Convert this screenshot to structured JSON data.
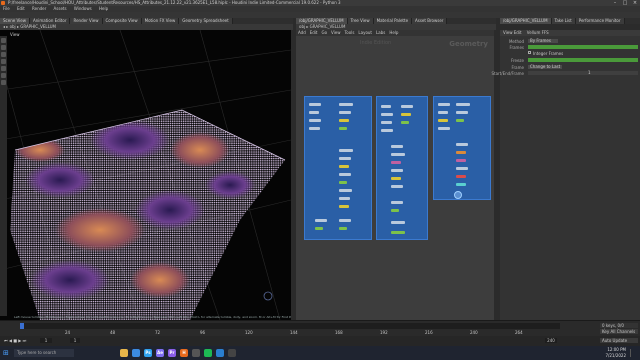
{
  "window": {
    "title": "P:/freelance/Houdini_School/HOU_Attributes/StudentResources/HS_Attributes_21.12.22_v21.3625E1_L58.hiplc - Houdini Indie Limited-Commercial 19.0.622 - Python 3"
  },
  "menu": {
    "items": [
      "File",
      "Edit",
      "Render",
      "Assets",
      "Windows",
      "Help"
    ]
  },
  "viewer": {
    "tabs": [
      "Scene View",
      "Animation Editor",
      "Render View",
      "Composite View",
      "Motion FX View",
      "Geometry Spreadsheet"
    ],
    "path": "obj",
    "node": "GRAPHIC_VELLUM",
    "view_label": "View",
    "status": "Left mouse tumbles. Middle pans. Right dollies. Ctrl+Alt+Left box-zooms. Ctrl+Right zooms. Spacebar Ctrl+Left tilts. Hold L for alternate tumble, dolly, and zoom.    M or Alt+M for First Person Navigation."
  },
  "network": {
    "tabs": [
      "/obj/GRAPHIC_VELLUM",
      "Tree View",
      "Material Palette",
      "Asset Browser"
    ],
    "menu": [
      "Add",
      "Edit",
      "Go",
      "View",
      "Tools",
      "Layout",
      "Labs",
      "Help"
    ],
    "path": "obj",
    "node": "GRAPHIC_VELLUM",
    "context_label": "Geometry",
    "mode_label": "Indie Edition"
  },
  "params": {
    "tabs": [
      "/obj/GRAPHIC_VELLUM",
      "Take List",
      "Performance Monitor"
    ],
    "node_type": "View Edit",
    "node_name": "Vellum FFS",
    "rows": [
      {
        "label": "Method",
        "value": "By Frames"
      },
      {
        "label": "Frames",
        "value": ""
      },
      {
        "label": "",
        "value": "Integer Frames"
      },
      {
        "label": "Freeze",
        "value": ""
      },
      {
        "label": "Frame",
        "value": "Change to Last"
      },
      {
        "label": "Start/End/Frame",
        "value": "1"
      }
    ]
  },
  "timeline": {
    "ticks": [
      "24",
      "48",
      "72",
      "96",
      "120",
      "144",
      "168",
      "192",
      "216",
      "240",
      "264"
    ],
    "frame": "1",
    "start": "1",
    "end": "240",
    "current": "1",
    "fps_label": "0 keys, 0/0 channels",
    "key_all": "Key All Channels",
    "auto_update": "Auto Update"
  },
  "taskbar": {
    "search_placeholder": "Type here to search",
    "time": "12:00 PM",
    "date": "7/21/2022",
    "apps": [
      {
        "name": "explorer",
        "color": "#e8b64a",
        "glyph": ""
      },
      {
        "name": "chrome",
        "color": "#3c8be0",
        "glyph": ""
      },
      {
        "name": "photoshop",
        "color": "#2fa3f0",
        "glyph": "Ps"
      },
      {
        "name": "after-effects",
        "color": "#7d6ef0",
        "glyph": "Ae"
      },
      {
        "name": "premiere",
        "color": "#8a5ee8",
        "glyph": "Pr"
      },
      {
        "name": "houdini",
        "color": "#e86a1c",
        "glyph": "H"
      },
      {
        "name": "obs",
        "color": "#555",
        "glyph": ""
      },
      {
        "name": "spotify",
        "color": "#1db954",
        "glyph": ""
      },
      {
        "name": "vscode",
        "color": "#2a7fd0",
        "glyph": ""
      },
      {
        "name": "terminal",
        "color": "#444",
        "glyph": ""
      }
    ]
  }
}
